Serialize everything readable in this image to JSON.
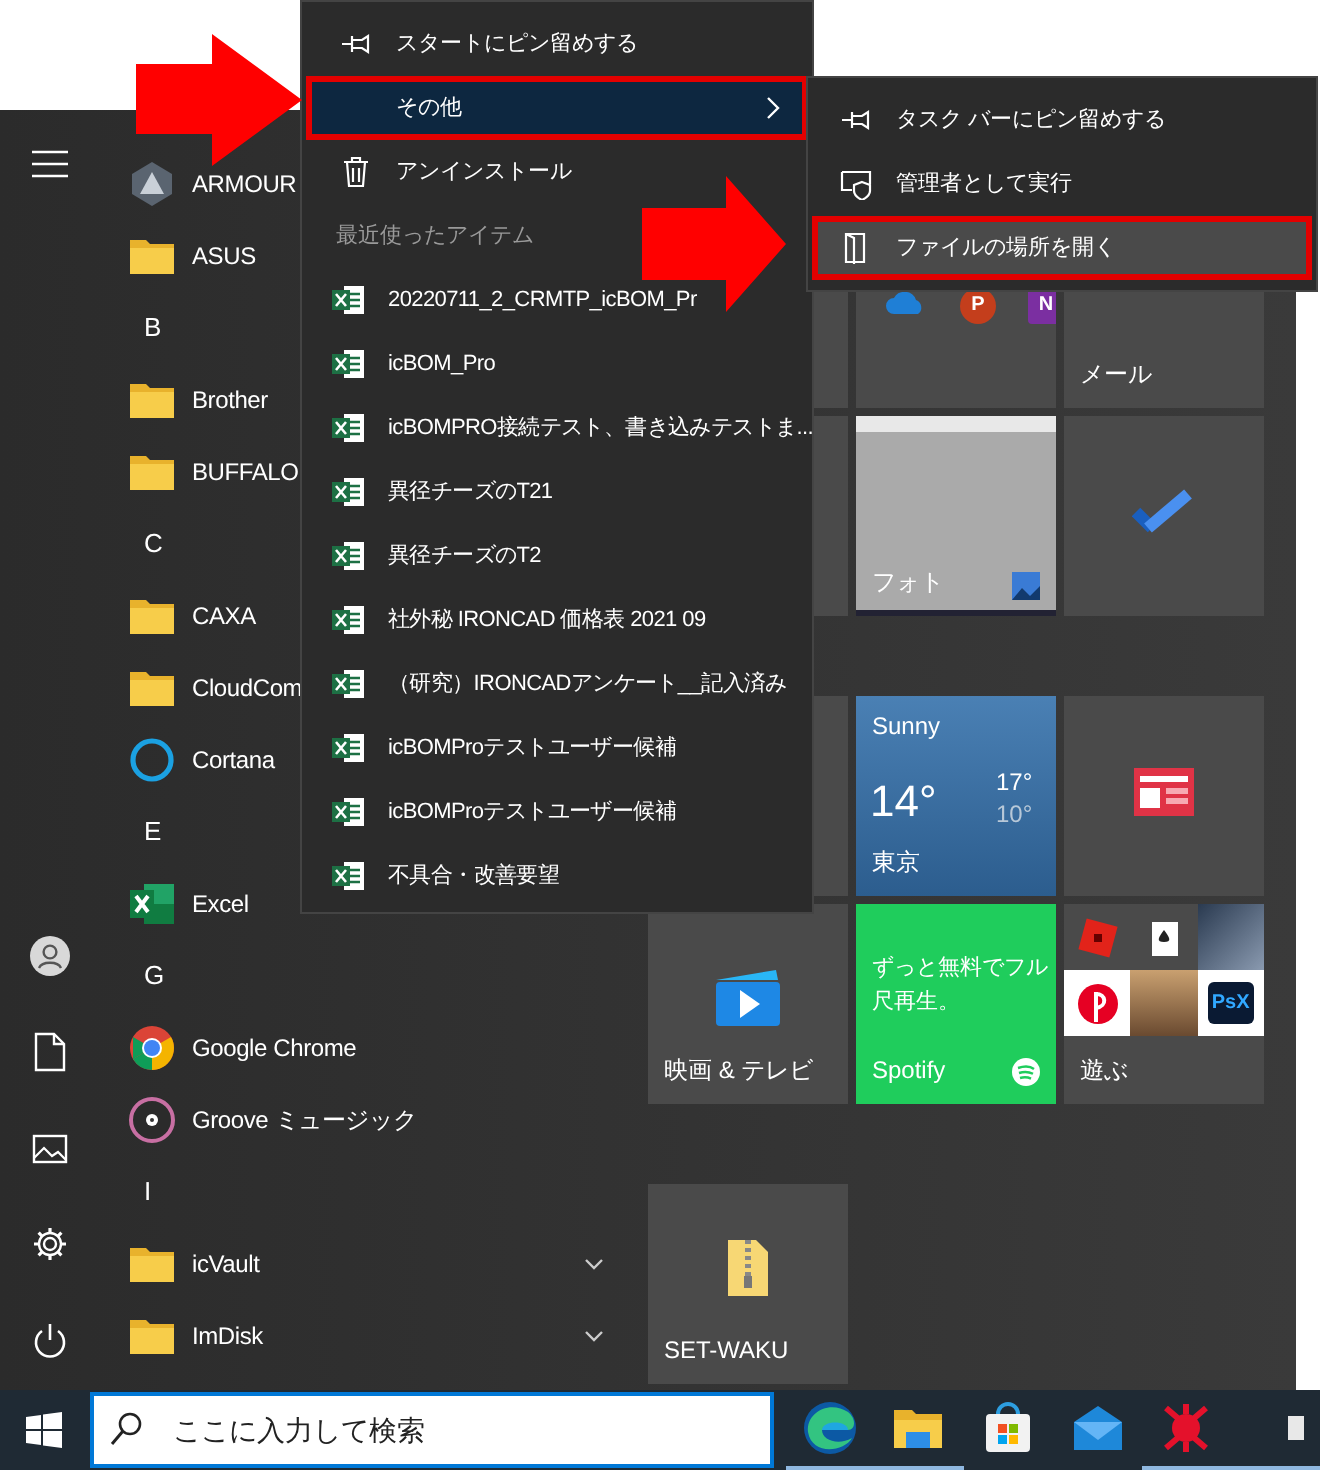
{
  "app_list": [
    {
      "kind": "armoury",
      "label": "ARMOUR"
    },
    {
      "kind": "folder",
      "label": "ASUS"
    },
    {
      "kind": "letter",
      "label": "B"
    },
    {
      "kind": "folder",
      "label": "Brother"
    },
    {
      "kind": "folder",
      "label": "BUFFALO"
    },
    {
      "kind": "letter",
      "label": "C"
    },
    {
      "kind": "folder",
      "label": "CAXA"
    },
    {
      "kind": "folder",
      "label": "CloudCom"
    },
    {
      "kind": "cortana",
      "label": "Cortana"
    },
    {
      "kind": "letter",
      "label": "E"
    },
    {
      "kind": "excel",
      "label": "Excel"
    },
    {
      "kind": "letter",
      "label": "G"
    },
    {
      "kind": "chrome",
      "label": "Google Chrome",
      "expandable": false
    },
    {
      "kind": "groove",
      "label": "Groove ミュージック",
      "expandable": false
    },
    {
      "kind": "letter",
      "label": "I"
    },
    {
      "kind": "folder",
      "label": "icVault",
      "expandable": true
    },
    {
      "kind": "folder",
      "label": "ImDisk",
      "expandable": true
    }
  ],
  "tile_groups": [
    [
      {
        "kind": "blank"
      },
      {
        "kind": "office",
        "badges": [
          "P",
          "N"
        ]
      },
      {
        "kind": "mail",
        "label": "メール"
      },
      {
        "kind": "blank"
      },
      {
        "kind": "photos",
        "label": "フォト"
      },
      {
        "kind": "todo"
      }
    ],
    [
      {
        "kind": "blank"
      },
      {
        "kind": "weather",
        "condition": "Sunny",
        "temp": "14°",
        "high": "17°",
        "low": "10°",
        "label": "東京"
      },
      {
        "kind": "news"
      },
      {
        "kind": "movies",
        "label": "映画 & テレビ"
      },
      {
        "kind": "spotify",
        "promo": "ずっと無料でフル尺再生。",
        "label": "Spotify"
      },
      {
        "kind": "games",
        "label": "遊ぶ",
        "logo_text": "PsX"
      }
    ],
    [
      {
        "kind": "archive",
        "label": "SET-WAKU"
      }
    ]
  ],
  "context_menu": {
    "items": [
      {
        "kind": "pin",
        "label": "スタートにピン留めする",
        "selected": false,
        "submenu": false,
        "annotated": false
      },
      {
        "kind": "none",
        "label": "その他",
        "selected": true,
        "submenu": true,
        "annotated": true
      },
      {
        "kind": "trash",
        "label": "アンインストール",
        "selected": false,
        "submenu": false,
        "annotated": false
      }
    ],
    "recent_header": "最近使ったアイテム",
    "recent_items": [
      {
        "label": "20220711_2_CRMTP_icBOM_Pr"
      },
      {
        "label": "icBOM_Pro"
      },
      {
        "label": "icBOMPRO接続テスト、書き込みテストま..."
      },
      {
        "label": "異径チーズのT21"
      },
      {
        "label": "異径チーズのT2"
      },
      {
        "label": "社外秘 IRONCAD 価格表 2021 09"
      },
      {
        "label": "（研究）IRONCADアンケート__記入済み"
      },
      {
        "label": "icBOMProテストユーザー候補"
      },
      {
        "label": "icBOMProテストユーザー候補"
      },
      {
        "label": "不具合・改善要望"
      }
    ]
  },
  "submenu": {
    "items": [
      {
        "kind": "pin",
        "label": "タスク バーにピン留めする",
        "selected": false,
        "annotated": false
      },
      {
        "kind": "admin",
        "label": "管理者として実行",
        "selected": false,
        "annotated": false
      },
      {
        "kind": "folder",
        "label": "ファイルの場所を開く",
        "selected": true,
        "annotated": true
      }
    ]
  },
  "taskbar": {
    "search": {
      "placeholder": "ここに入力して検索"
    },
    "apps": [
      {
        "kind": "edge",
        "running": true
      },
      {
        "kind": "explorer",
        "running": true
      },
      {
        "kind": "store",
        "running": false
      },
      {
        "kind": "mail",
        "running": false
      },
      {
        "kind": "red-app",
        "running": true
      },
      {
        "kind": "partial",
        "running": true
      }
    ]
  }
}
